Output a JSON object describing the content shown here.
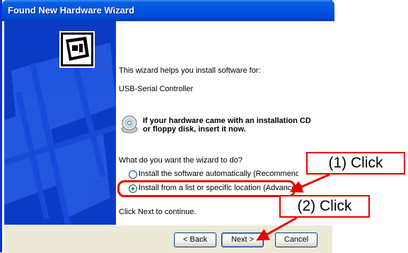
{
  "window": {
    "title": "Found New Hardware Wizard"
  },
  "content": {
    "intro": "This wizard helps you install software for:",
    "device": "USB-Serial Controller",
    "cd_line1": "If your hardware came with an installation CD",
    "cd_line2": "or floppy disk, insert it now.",
    "question": "What do you want the wizard to do?",
    "option_auto": "Install the software automatically (Recommended)",
    "option_advanced": "Install from a list or specific location (Advanced)",
    "selected_option": "option_advanced",
    "continue_text": "Click Next to continue."
  },
  "buttons": {
    "back": "< Back",
    "next": "Next >",
    "cancel": "Cancel"
  },
  "annotations": {
    "click1": "(1) Click",
    "click2": "(2) Click",
    "color": "#e80000"
  },
  "icons": {
    "wizard": "hardware-card-icon",
    "cd": "cd-disk-icon"
  }
}
